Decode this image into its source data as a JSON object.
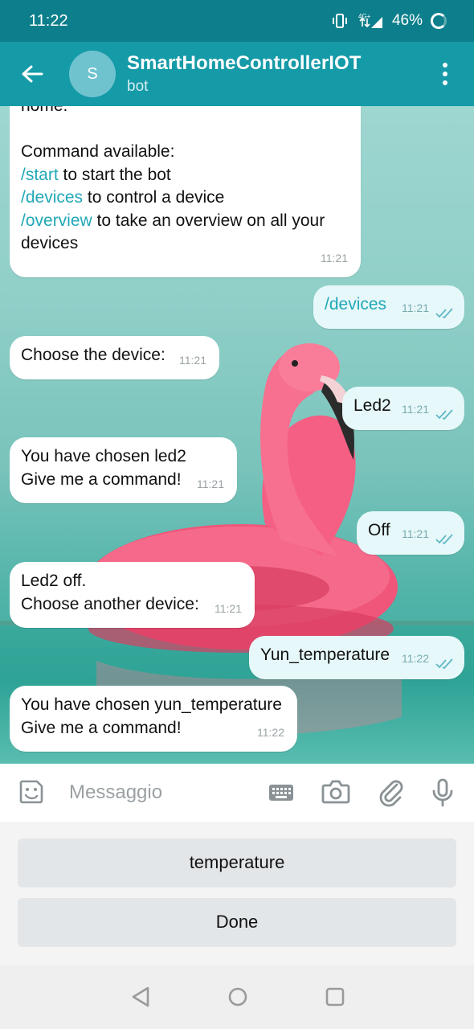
{
  "status_bar": {
    "time": "11:22",
    "network": "4G+",
    "battery": "46%"
  },
  "header": {
    "avatar_initial": "S",
    "title": "SmartHomeControllerIOT",
    "subtitle": "bot"
  },
  "messages": [
    {
      "direction": "in",
      "lines": [
        {
          "text": "home."
        },
        {
          "text": ""
        },
        {
          "text": "Command available:"
        },
        {
          "cmd": "/start",
          "text": " to start the bot"
        },
        {
          "cmd": "/devices",
          "text": " to control a device"
        },
        {
          "cmd": "/overview",
          "text": " to take an overview on all your"
        },
        {
          "text": "devices"
        }
      ],
      "time": "11:21"
    },
    {
      "direction": "out",
      "text": "/devices",
      "is_command": true,
      "time": "11:21"
    },
    {
      "direction": "in",
      "text": "Choose the device:",
      "time": "11:21"
    },
    {
      "direction": "out",
      "text": "Led2",
      "time": "11:21"
    },
    {
      "direction": "in",
      "lines": [
        {
          "text": "You have chosen led2"
        },
        {
          "text": "Give me a command!"
        }
      ],
      "time": "11:21"
    },
    {
      "direction": "out",
      "text": "Off",
      "time": "11:21"
    },
    {
      "direction": "in",
      "lines": [
        {
          "text": "Led2 off."
        },
        {
          "text": "Choose another device:"
        }
      ],
      "time": "11:21"
    },
    {
      "direction": "out",
      "text": "Yun_temperature",
      "time": "11:22"
    },
    {
      "direction": "in",
      "lines": [
        {
          "text": "You have chosen yun_temperature"
        },
        {
          "text": "Give me a command!"
        }
      ],
      "time": "11:22"
    }
  ],
  "input": {
    "placeholder": "Messaggio"
  },
  "bot_keyboard": {
    "buttons": [
      "temperature",
      "Done"
    ]
  },
  "icons": {
    "back": "arrow-left-icon",
    "menu": "more-vertical-icon",
    "emoji": "sticker-emoji-icon",
    "keyboard": "keyboard-icon",
    "camera": "camera-icon",
    "attach": "paperclip-icon",
    "mic": "microphone-icon"
  },
  "colors": {
    "status_bar": "#0d7f8c",
    "header": "#159aa7",
    "command_link": "#21a8b7",
    "outgoing_bubble": "#e6f8f9",
    "incoming_bubble": "#ffffff",
    "read_checks": "#5fb8c6"
  }
}
